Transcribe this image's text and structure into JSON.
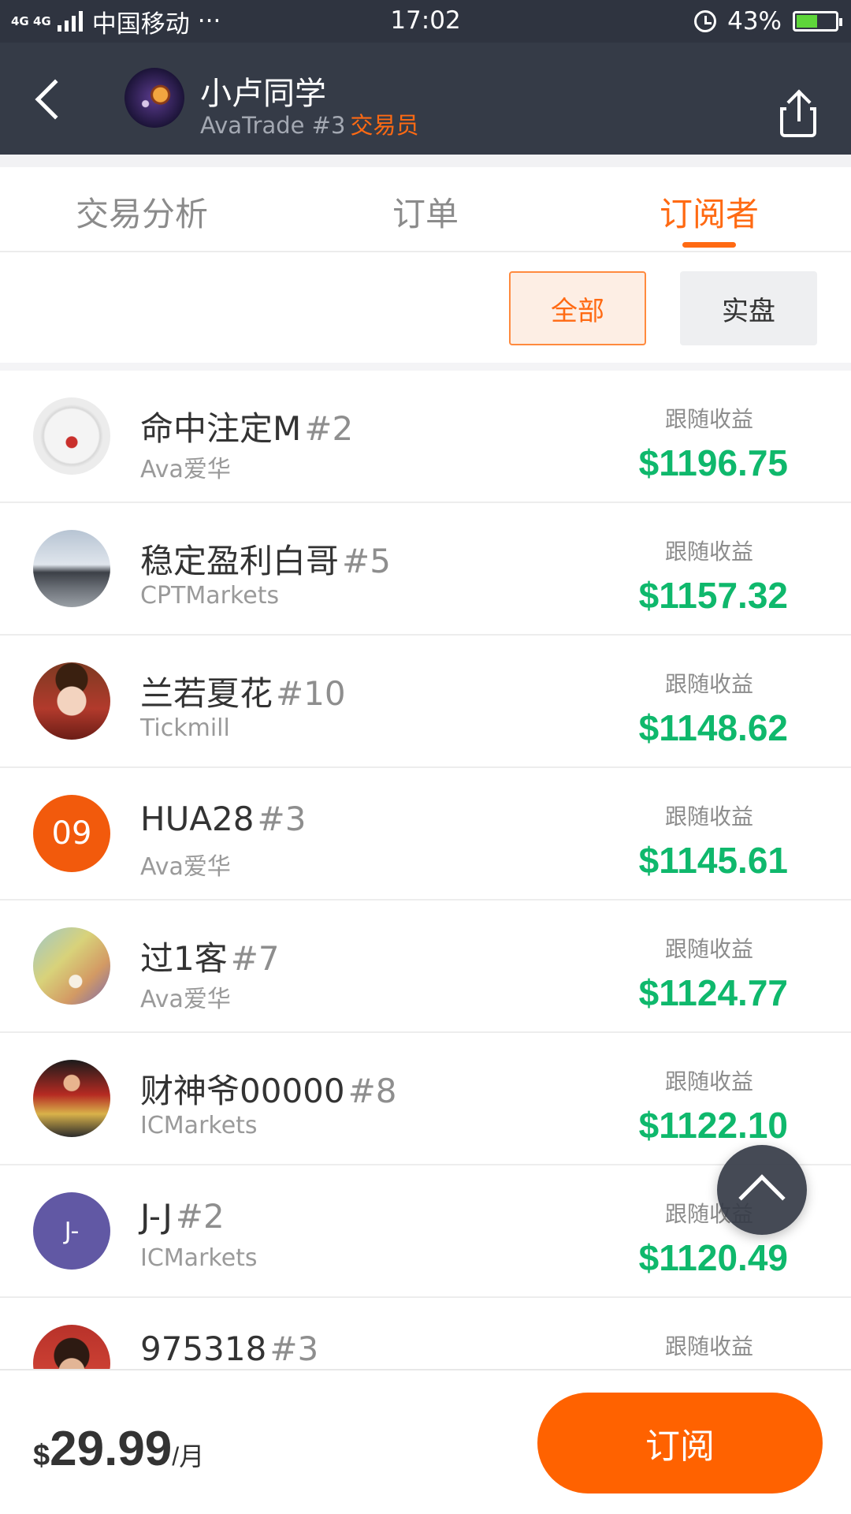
{
  "status_bar": {
    "network": "4G 4G",
    "carrier": "中国移动",
    "dots": "···",
    "time": "17:02",
    "battery": "43%"
  },
  "header": {
    "name": "小卢同学",
    "broker": "AvaTrade #3",
    "role": "交易员"
  },
  "tabs": [
    {
      "label": "交易分析",
      "active": false
    },
    {
      "label": "订单",
      "active": false
    },
    {
      "label": "订阅者",
      "active": true
    }
  ],
  "filters": {
    "all": "全部",
    "real": "实盘"
  },
  "subscribers": [
    {
      "name": "命中注定M",
      "rank": "#2",
      "broker": "Ava爱华",
      "label": "跟随收益",
      "value": "$1196.75",
      "avatar_text": ""
    },
    {
      "name": "稳定盈利白哥",
      "rank": "#5",
      "broker": "CPTMarkets",
      "label": "跟随收益",
      "value": "$1157.32",
      "avatar_text": ""
    },
    {
      "name": "兰若夏花",
      "rank": "#10",
      "broker": "Tickmill",
      "label": "跟随收益",
      "value": "$1148.62",
      "avatar_text": ""
    },
    {
      "name": "HUA28",
      "rank": "#3",
      "broker": "Ava爱华",
      "label": "跟随收益",
      "value": "$1145.61",
      "avatar_text": "09"
    },
    {
      "name": "过1客",
      "rank": "#7",
      "broker": "Ava爱华",
      "label": "跟随收益",
      "value": "$1124.77",
      "avatar_text": ""
    },
    {
      "name": "财神爷00000",
      "rank": "#8",
      "broker": "ICMarkets",
      "label": "跟随收益",
      "value": "$1122.10",
      "avatar_text": ""
    },
    {
      "name": "J-J",
      "rank": "#2",
      "broker": "ICMarkets",
      "label": "跟随收益",
      "value": "$1120.49",
      "avatar_text": "J-"
    },
    {
      "name": "975318",
      "rank": "#3",
      "broker": "",
      "label": "跟随收益",
      "value": "",
      "avatar_text": ""
    }
  ],
  "bottom": {
    "currency": "$",
    "price": "29.99",
    "unit": "/月",
    "subscribe": "订阅"
  },
  "colors": {
    "accent": "#ff6a13",
    "profit": "#0fb86c",
    "header_bg": "#353b47"
  }
}
